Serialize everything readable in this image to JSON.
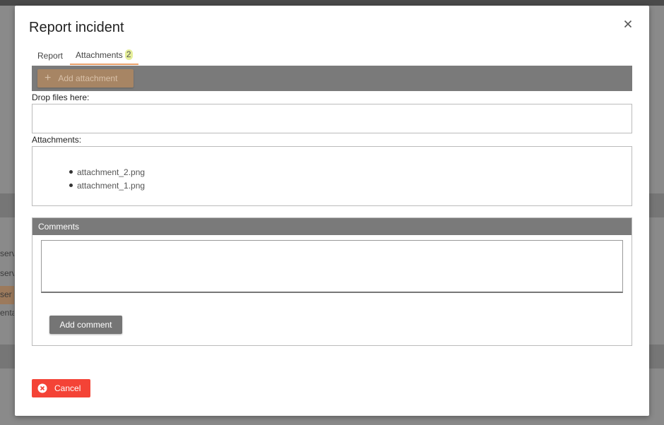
{
  "background": {
    "rows": [
      "serv",
      "serv",
      "ser",
      "enta"
    ]
  },
  "modal": {
    "title": "Report incident",
    "close_icon": "close-icon",
    "tabs": [
      {
        "label": "Report"
      },
      {
        "label": "Attachments",
        "badge": "2"
      }
    ],
    "toolbar": {
      "add_attachment_label": "Add attachment",
      "icon": "plus-icon"
    },
    "drop_label": "Drop files here:",
    "attachments_label": "Attachments:",
    "attachments": [
      "attachment_2.png",
      "attachment_1.png"
    ],
    "comments": {
      "header": "Comments",
      "input_value": "",
      "add_button_label": "Add comment"
    },
    "cancel_label": "Cancel",
    "cancel_icon": "cancel-circle-icon"
  },
  "colors": {
    "accent": "#e8a06a",
    "badge": "#e5ee9a",
    "danger": "#f44336",
    "toolbar": "#7a7a7a"
  }
}
